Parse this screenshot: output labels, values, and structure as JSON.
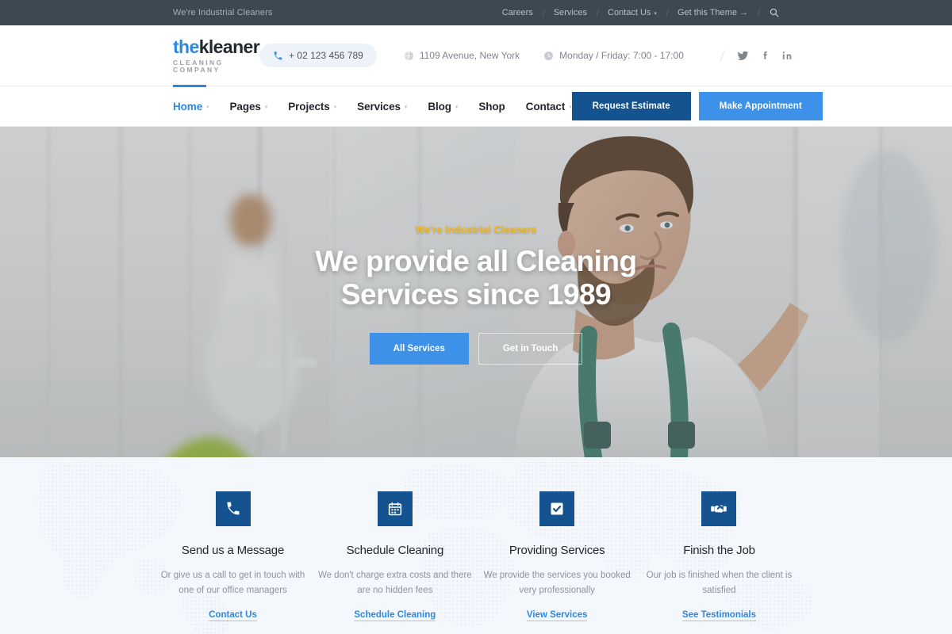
{
  "topbar": {
    "tagline": "We're Industrial Cleaners",
    "links": [
      {
        "label": "Careers",
        "caret": ""
      },
      {
        "label": "Services",
        "caret": ""
      },
      {
        "label": "Contact Us",
        "caret": "▾"
      },
      {
        "label": "Get this Theme →",
        "caret": ""
      }
    ],
    "search_icon": "search-icon"
  },
  "header": {
    "logo": {
      "part1": "the",
      "part2": "kleaner",
      "subtitle": "CLEANING COMPANY"
    },
    "phone": "+ 02 123 456 789",
    "address": "1109 Avenue, New York",
    "hours": "Monday / Friday: 7:00 - 17:00",
    "socials": [
      "twitter-icon",
      "facebook-icon",
      "linkedin-icon"
    ]
  },
  "mainnav": {
    "items": [
      {
        "label": "Home",
        "caret": "▾",
        "active": true
      },
      {
        "label": "Pages",
        "caret": "▾",
        "active": false
      },
      {
        "label": "Projects",
        "caret": "▾",
        "active": false
      },
      {
        "label": "Services",
        "caret": "▾",
        "active": false
      },
      {
        "label": "Blog",
        "caret": "▾",
        "active": false
      },
      {
        "label": "Shop",
        "caret": "",
        "active": false
      },
      {
        "label": "Contact",
        "caret": "▾",
        "active": false
      }
    ],
    "btn_estimate": "Request Estimate",
    "btn_appointment": "Make Appointment"
  },
  "hero": {
    "kicker": "We're Industrial Cleaners",
    "title": "We provide all Cleaning Services since 1989",
    "btn_primary": "All Services",
    "btn_secondary": "Get in Touch"
  },
  "features": [
    {
      "icon": "phone-icon",
      "title": "Send us a Message",
      "desc": "Or give us a call to get in touch with one of our office managers",
      "link": "Contact Us"
    },
    {
      "icon": "calendar-icon",
      "title": "Schedule Cleaning",
      "desc": "We don't charge extra costs and there are no hidden fees",
      "link": "Schedule Cleaning"
    },
    {
      "icon": "checkbox-icon",
      "title": "Providing Services",
      "desc": "We provide the services you booked very professionally",
      "link": "View Services"
    },
    {
      "icon": "handshake-icon",
      "title": "Finish the Job",
      "desc": "Our job is finished when the client is satisfied",
      "link": "See Testimonials"
    }
  ],
  "colors": {
    "topbar_bg": "#3d4852",
    "accent_blue": "#2f88e0",
    "dark_blue": "#14538f",
    "light_blue": "#3d91e8",
    "hero_kicker": "#f5b818",
    "features_bg": "#f4f7fb"
  }
}
